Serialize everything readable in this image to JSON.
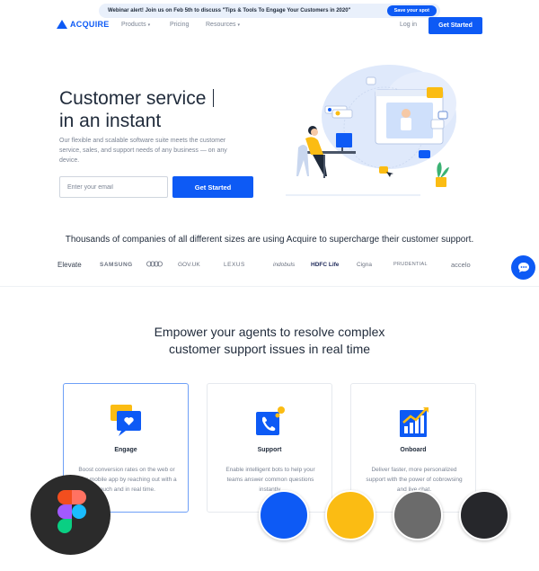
{
  "banner": {
    "text": "Webinar alert! Join us on Feb 5th to discuss \"Tips & Tools To Engage Your Customers in 2020\"",
    "button": "Save your spot"
  },
  "nav": {
    "logo": "ACQUIRE",
    "items": [
      "Products",
      "Pricing",
      "Resources"
    ],
    "login": "Log in",
    "cta": "Get Started"
  },
  "hero": {
    "title_line1": "Customer service",
    "title_line2": "in an instant",
    "subtitle": "Our flexible and scalable software suite meets the customer service, sales, and support needs of any business — on any device.",
    "email_placeholder": "Enter your email",
    "cta": "Get Started"
  },
  "companies": {
    "text": "Thousands of companies of all different sizes are using Acquire to supercharge their customer support.",
    "logos": [
      "Elevate",
      "SAMSUNG",
      "Audi",
      "GOV.UK",
      "LEXUS",
      "indobuls",
      "HDFC Life",
      "Cigna",
      "PRUDENTIAL",
      "accelo"
    ]
  },
  "features": {
    "title_line1": "Empower your agents to resolve complex",
    "title_line2": "customer support issues in real time",
    "cards": [
      {
        "title": "Engage",
        "desc": "Boost conversion rates on the web or your mobile app by reaching out with a touch and in real time."
      },
      {
        "title": "Support",
        "desc": "Enable intelligent bots to help your teams answer common questions instantly."
      },
      {
        "title": "Onboard",
        "desc": "Deliver faster, more personalized support with the power of cobrowsing and live chat."
      }
    ]
  },
  "palette": [
    "#0d5af5",
    "#fbbc13",
    "#6b6b6b",
    "#26272b"
  ],
  "icons": [
    "chat-icon",
    "figma-logo"
  ]
}
